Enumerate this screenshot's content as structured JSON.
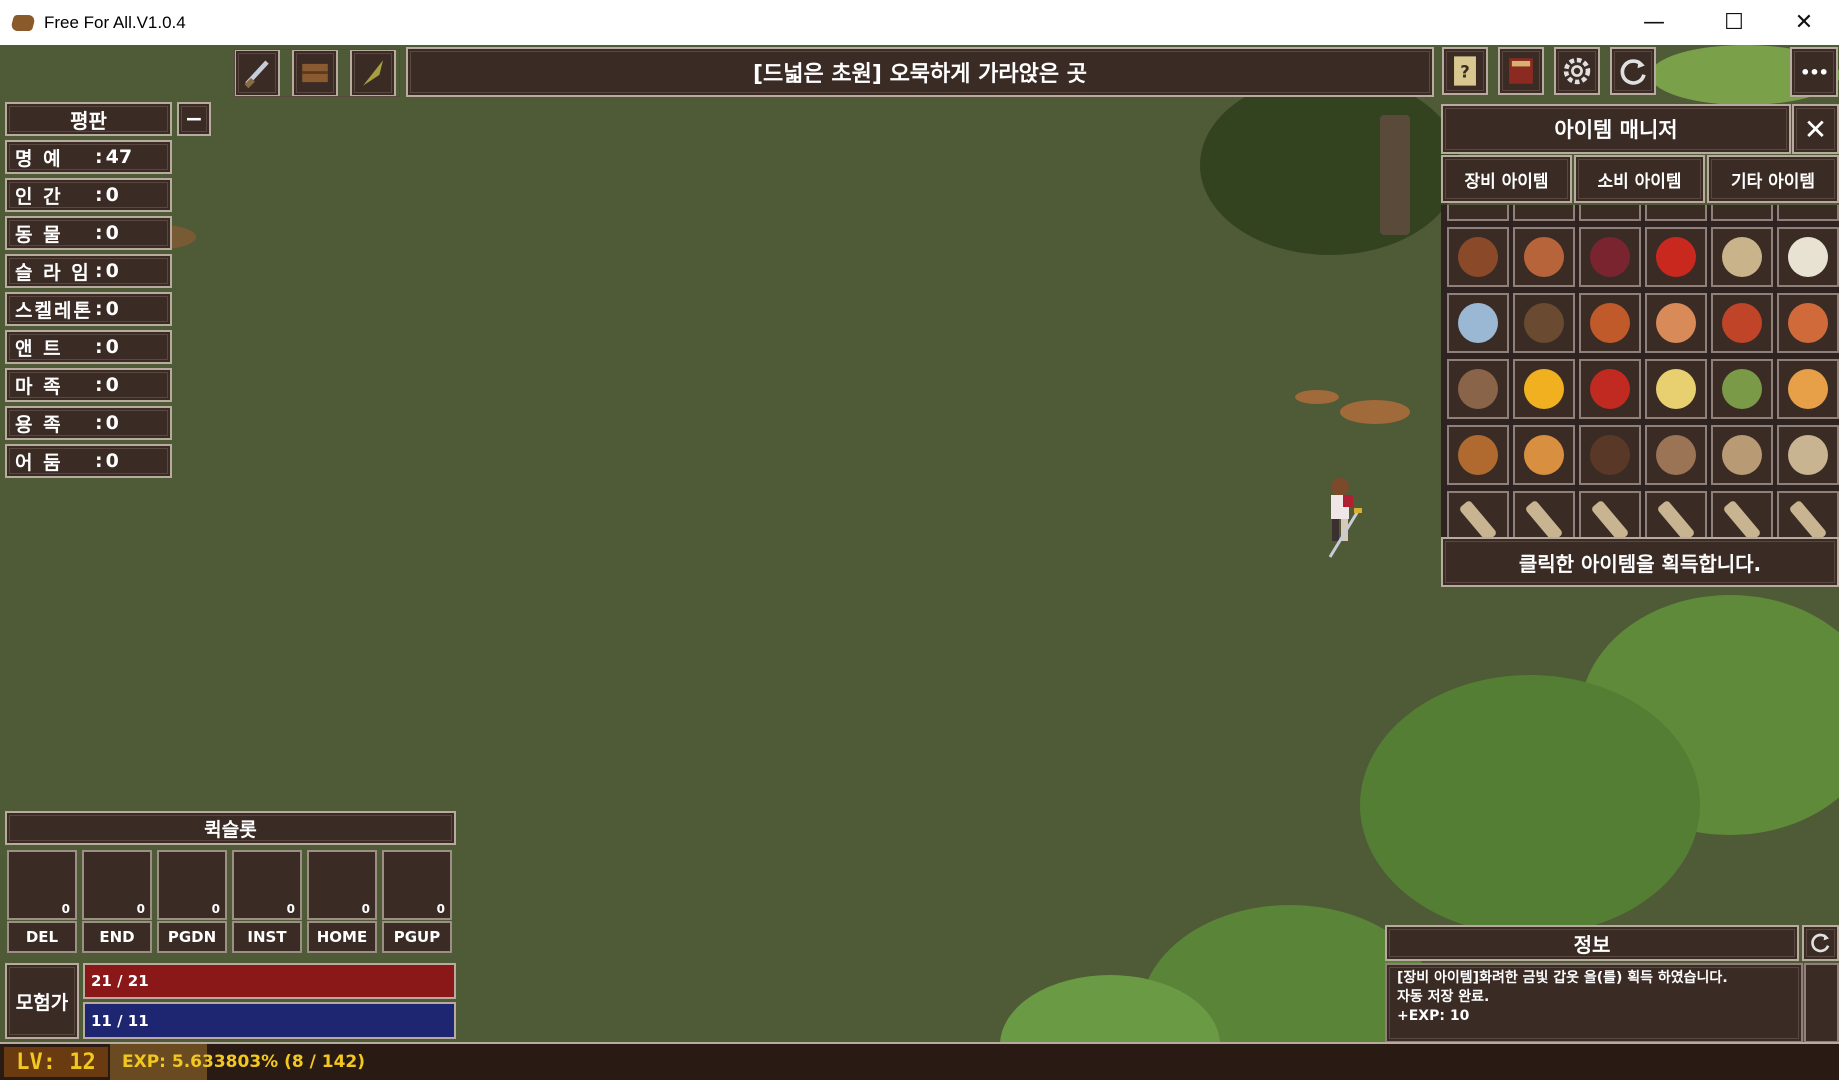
{
  "window": {
    "title": "Free For All.V1.0.4",
    "minimize_glyph": "—",
    "maximize_glyph": "☐",
    "close_glyph": "✕"
  },
  "hud": {
    "location_title": "[드넓은 초원] 오묵하게 가라앉은 곳",
    "menu_glyph": "•••",
    "left_buttons": [
      "sword-icon",
      "chest-icon",
      "feather-icon"
    ],
    "right_buttons": [
      "quest-scroll-icon",
      "book-icon",
      "gear-icon",
      "refresh-icon"
    ]
  },
  "reputation": {
    "title": "평판",
    "collapse_glyph": "−",
    "rows": [
      {
        "label": "명   예",
        "value": "47"
      },
      {
        "label": "인   간",
        "value": "0"
      },
      {
        "label": "동   물",
        "value": "0"
      },
      {
        "label": "슬 라 임",
        "value": "0"
      },
      {
        "label": "스켈레톤",
        "value": "0"
      },
      {
        "label": "앤   트",
        "value": "0"
      },
      {
        "label": "마   족",
        "value": "0"
      },
      {
        "label": "용   족",
        "value": "0"
      },
      {
        "label": "어   둠",
        "value": "0"
      }
    ]
  },
  "item_manager": {
    "title": "아이템 매니저",
    "close_glyph": "✕",
    "tabs": [
      "장비 아이템",
      "소비 아이템",
      "기타 아이템"
    ],
    "footer": "클릭한 아이템을 획득합니다.",
    "rows": [
      [
        "#8a4a2a",
        "#b8643a",
        "#7a2430",
        "#c8281e",
        "#c9b38a",
        "#e8e2d2"
      ],
      [
        "#9ab8d4",
        "#6a4a30",
        "#c05a2a",
        "#d88a58",
        "#c04428",
        "#d06a3a"
      ],
      [
        "#8a6448",
        "#f0b020",
        "#c02a20",
        "#e8d070",
        "#7a9a48",
        "#e8a048"
      ],
      [
        "#b06a30",
        "#d89040",
        "#5a3828",
        "#9a7454",
        "#b89a74",
        "#c8b490"
      ],
      [
        "#c8b490",
        "#c8b490",
        "#c8b490",
        "#c8b490",
        "#c8b490",
        "#c8b490"
      ]
    ]
  },
  "quickslot": {
    "title": "퀵슬롯",
    "slots": [
      {
        "key": "DEL",
        "count": "0"
      },
      {
        "key": "END",
        "count": "0"
      },
      {
        "key": "PGDN",
        "count": "0"
      },
      {
        "key": "INST",
        "count": "0"
      },
      {
        "key": "HOME",
        "count": "0"
      },
      {
        "key": "PGUP",
        "count": "0"
      }
    ]
  },
  "character": {
    "class_name": "모험가",
    "hp_text": "21 / 21",
    "hp_ratio": 1.0,
    "mp_text": "11 / 11",
    "mp_ratio": 1.0,
    "level_text": "LV: 12",
    "exp_text": "EXP: 5.633803% (8 / 142)",
    "exp_ratio": 0.0563
  },
  "info": {
    "title": "정보",
    "lines": [
      "[장비 아이템]화려한 금빛 갑옷 을(를) 획득 하였습니다.",
      "자동 저장 완료.",
      "+EXP: 10"
    ]
  },
  "colors": {
    "panel_bg": "#3a2b25",
    "panel_border": "#b9aaa0",
    "grass": "#4f5a36",
    "hp": "#8a1818",
    "mp": "#1e2672",
    "level_yellow": "#f2c81e"
  }
}
